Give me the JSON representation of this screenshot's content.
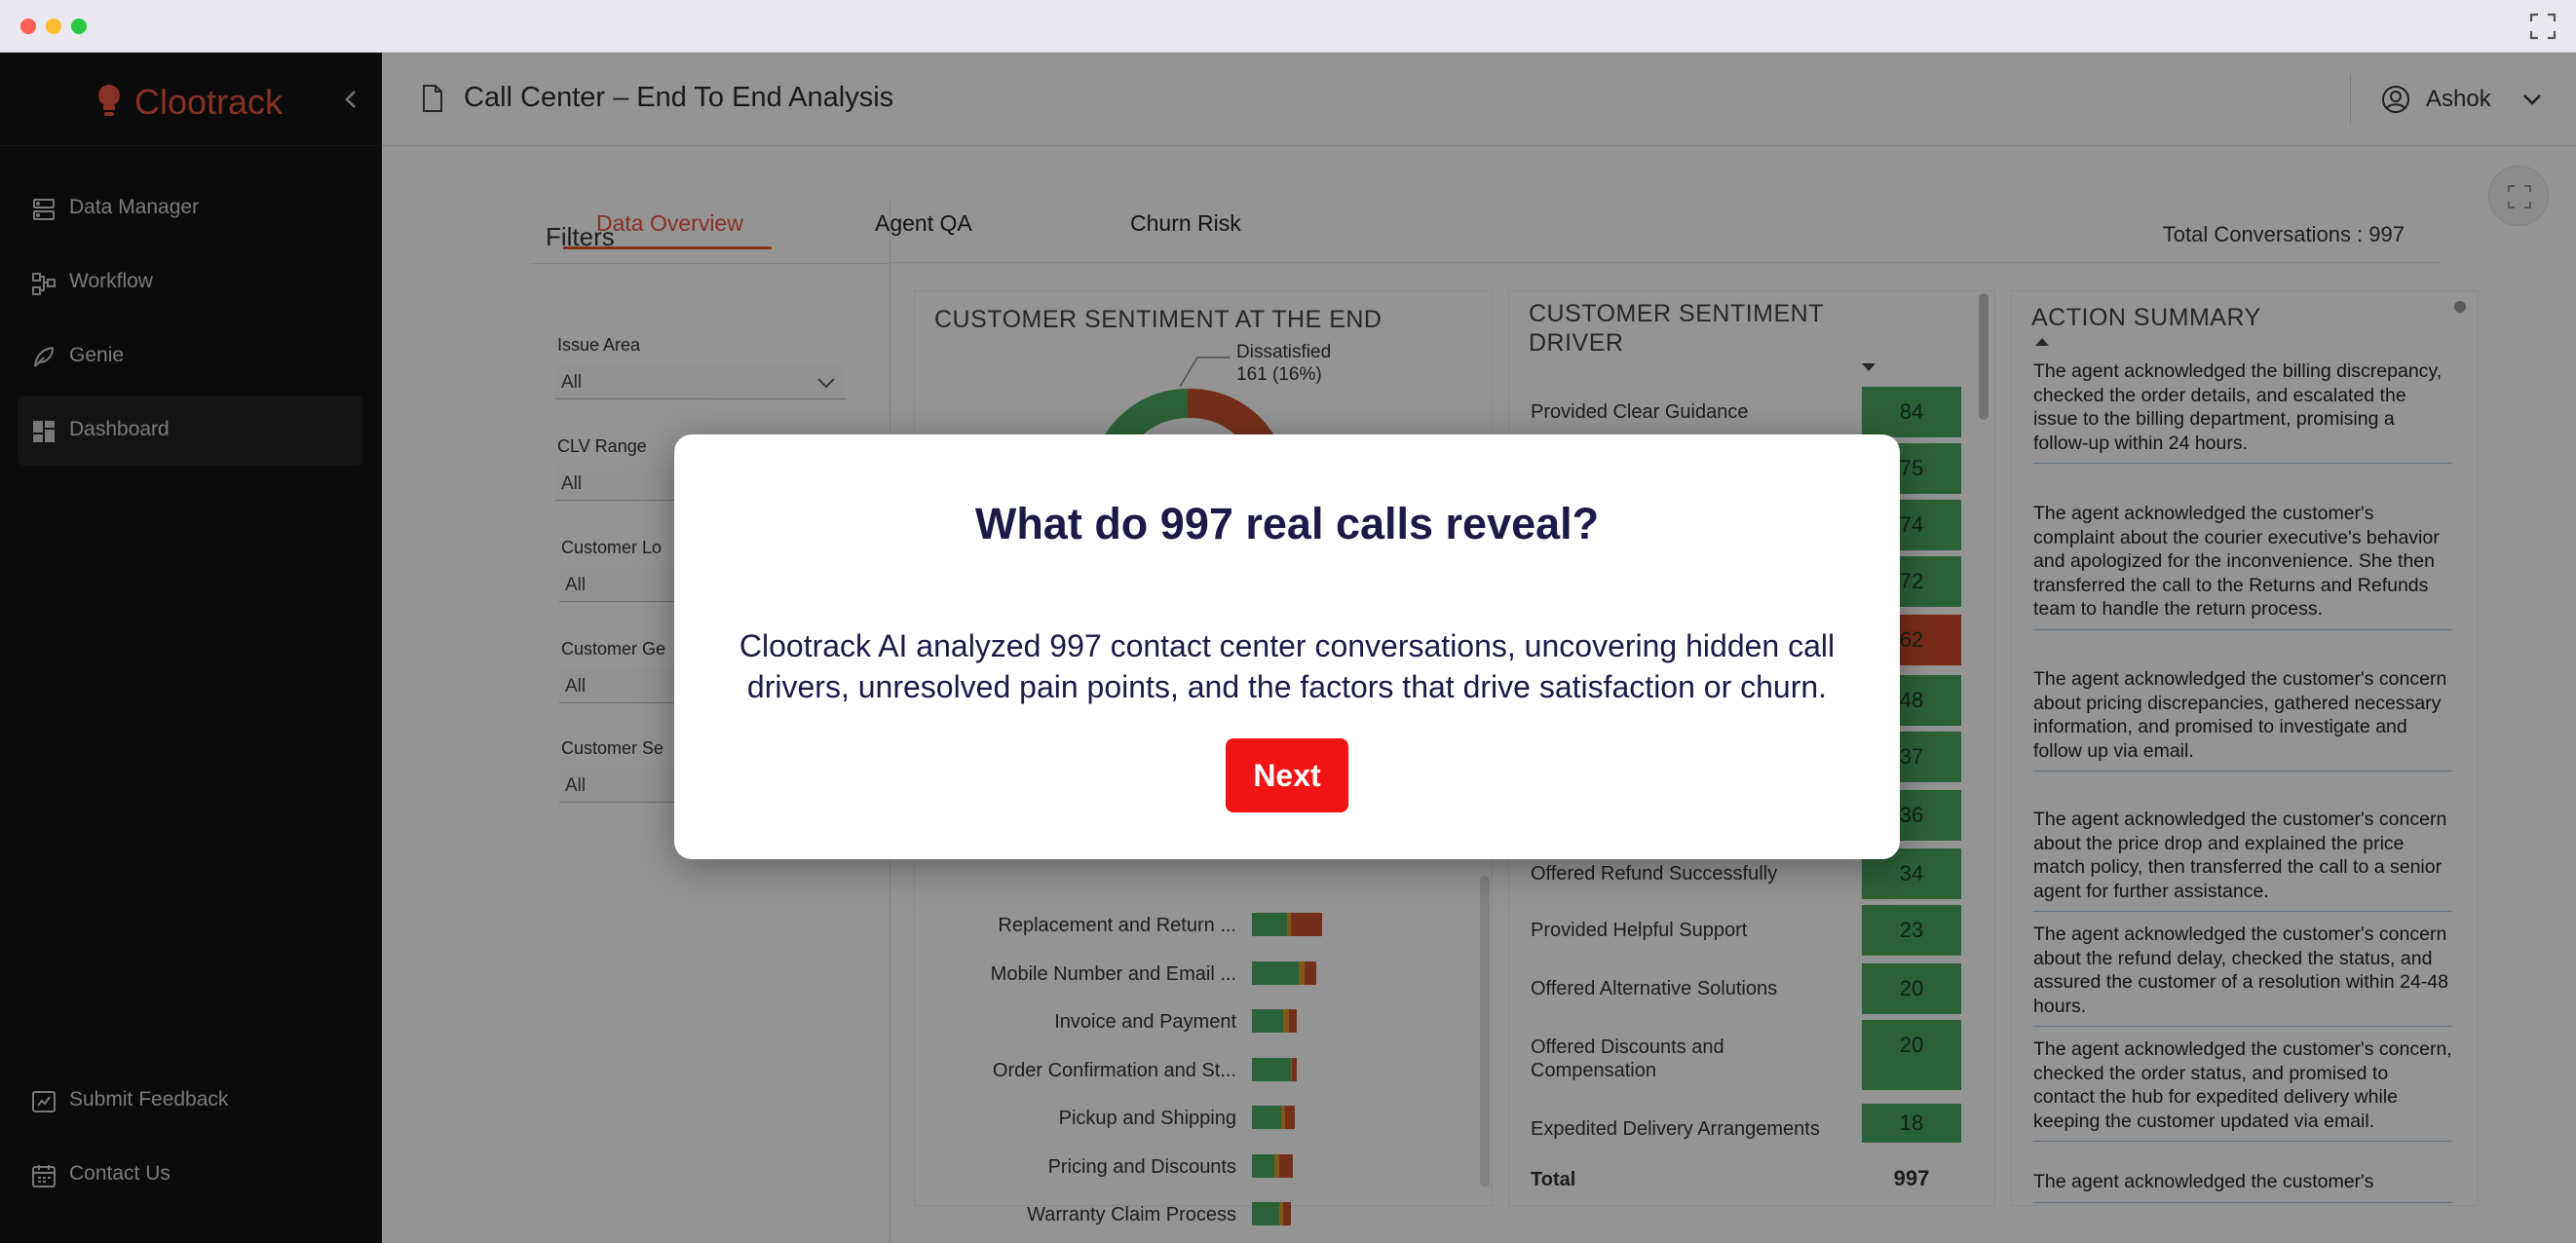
{
  "brand": {
    "name": "Clootrack",
    "accent": "#e8553b"
  },
  "sidebar": {
    "items": [
      {
        "label": "Data Manager",
        "icon": "database-icon"
      },
      {
        "label": "Workflow",
        "icon": "workflow-icon"
      },
      {
        "label": "Genie",
        "icon": "feather-icon"
      },
      {
        "label": "Dashboard",
        "icon": "dashboard-icon",
        "active": true
      }
    ],
    "bottom_items": [
      {
        "label": "Submit Feedback",
        "icon": "feedback-icon"
      },
      {
        "label": "Contact Us",
        "icon": "calendar-icon"
      }
    ]
  },
  "header": {
    "title": "Call Center – End To End Analysis",
    "user": "Ashok"
  },
  "tabs": [
    {
      "label": "Data Overview",
      "active": true
    },
    {
      "label": "Agent QA"
    },
    {
      "label": "Churn Risk"
    }
  ],
  "filters": {
    "title": "Filters",
    "items": [
      {
        "label": "Issue Area",
        "value": "All"
      },
      {
        "label": "CLV Range",
        "value": "All"
      },
      {
        "label": "Customer Lo",
        "value": "All"
      },
      {
        "label": "Customer Ge",
        "value": "All"
      },
      {
        "label": "Customer Se",
        "value": "All"
      }
    ]
  },
  "total_conversations": "Total Conversations : 997",
  "sentiment_end": {
    "title": "CUSTOMER SENTIMENT AT THE END",
    "callout_label": "Dissatisfied",
    "callout_value": "161 (16%)",
    "issue_bars": [
      {
        "label": "Replacement and Return ...",
        "segments": [
          0.5,
          0.06,
          0.44
        ]
      },
      {
        "label": "Mobile Number and Email ...",
        "segments": [
          0.72,
          0.1,
          0.18
        ]
      },
      {
        "label": "Invoice and Payment",
        "segments": [
          0.7,
          0.12,
          0.18
        ]
      },
      {
        "label": "Order Confirmation and St...",
        "segments": [
          0.86,
          0.04,
          0.1
        ]
      },
      {
        "label": "Pickup and Shipping",
        "segments": [
          0.68,
          0.1,
          0.22
        ]
      },
      {
        "label": "Pricing and Discounts",
        "segments": [
          0.54,
          0.12,
          0.34
        ]
      },
      {
        "label": "Warranty Claim Process",
        "segments": [
          0.7,
          0.1,
          0.2
        ]
      }
    ],
    "colors": {
      "satisfied": "#4aa860",
      "neutral": "#d69b2b",
      "dissatisfied": "#c9512f"
    }
  },
  "sentiment_driver": {
    "title_line1": "CUSTOMER SENTIMENT",
    "title_line2": "DRIVER",
    "rows": [
      {
        "label": "Provided Clear Guidance",
        "value": "84",
        "red": false
      },
      {
        "label": "",
        "value": "75",
        "red": false
      },
      {
        "label": "",
        "value": "74",
        "red": false
      },
      {
        "label": "",
        "value": "72",
        "red": false
      },
      {
        "label": "",
        "value": "62",
        "red": true
      },
      {
        "label": "",
        "value": "48",
        "red": false
      },
      {
        "label": "",
        "value": "37",
        "red": false
      },
      {
        "label": "",
        "value": "36",
        "red": false
      },
      {
        "label": "Offered Refund Successfully",
        "value": "34",
        "red": false
      },
      {
        "label": "Provided Helpful Support",
        "value": "23",
        "red": false
      },
      {
        "label": "Offered Alternative Solutions",
        "value": "20",
        "red": false
      },
      {
        "label": "Offered Discounts and Compensation",
        "value": "20",
        "red": false
      },
      {
        "label": "Expedited Delivery Arrangements",
        "value": "18",
        "red": false
      }
    ],
    "total_label": "Total",
    "total_value": "997"
  },
  "action_summary": {
    "title": "ACTION SUMMARY",
    "items": [
      "The agent acknowledged the billing discrepancy, checked the order details, and escalated the issue to the billing department, promising a follow-up within 24 hours.",
      "The agent acknowledged the customer's complaint about the courier executive's behavior and apologized for the inconvenience. She then transferred the call to the Returns and Refunds team to handle the return process.",
      "The agent acknowledged the customer's concern about pricing discrepancies, gathered necessary information, and promised to investigate and follow up via email.",
      "The agent acknowledged the customer's concern about the price drop and explained the price match policy, then transferred the call to a senior agent for further assistance.",
      "The agent acknowledged the customer's concern about the refund delay, checked the status, and assured the customer of a resolution within 24-48 hours.",
      "The agent acknowledged the customer's concern, checked the order status, and promised to contact the hub for expedited delivery while keeping the customer updated via email.",
      "The agent acknowledged the customer's"
    ]
  },
  "modal": {
    "title": "What do 997 real calls reveal?",
    "body": "Clootrack AI analyzed 997 contact center conversations, uncovering hidden call drivers, unresolved pain points, and the factors that drive satisfaction or churn.",
    "button": "Next"
  }
}
